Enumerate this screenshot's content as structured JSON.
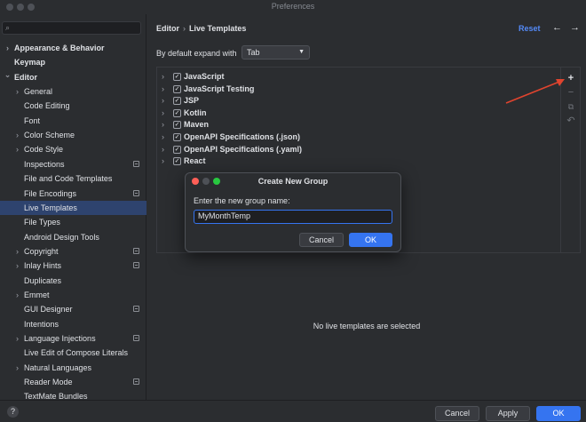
{
  "window": {
    "title": "Preferences"
  },
  "sidebar": {
    "items": [
      {
        "label": "Appearance & Behavior",
        "bold": true,
        "chevron": "right",
        "level": 0
      },
      {
        "label": "Keymap",
        "bold": true,
        "chevron": "",
        "level": 0
      },
      {
        "label": "Editor",
        "bold": true,
        "chevron": "down",
        "level": 0
      },
      {
        "label": "General",
        "chevron": "right",
        "level": 1
      },
      {
        "label": "Code Editing",
        "chevron": "",
        "level": 1
      },
      {
        "label": "Font",
        "chevron": "",
        "level": 1
      },
      {
        "label": "Color Scheme",
        "chevron": "right",
        "level": 1
      },
      {
        "label": "Code Style",
        "chevron": "right",
        "level": 1
      },
      {
        "label": "Inspections",
        "chevron": "",
        "level": 1,
        "badge": true
      },
      {
        "label": "File and Code Templates",
        "chevron": "",
        "level": 1
      },
      {
        "label": "File Encodings",
        "chevron": "",
        "level": 1,
        "badge": true
      },
      {
        "label": "Live Templates",
        "chevron": "",
        "level": 1,
        "selected": true
      },
      {
        "label": "File Types",
        "chevron": "",
        "level": 1
      },
      {
        "label": "Android Design Tools",
        "chevron": "",
        "level": 1
      },
      {
        "label": "Copyright",
        "chevron": "right",
        "level": 1,
        "badge": true
      },
      {
        "label": "Inlay Hints",
        "chevron": "right",
        "level": 1,
        "badge": true
      },
      {
        "label": "Duplicates",
        "chevron": "",
        "level": 1
      },
      {
        "label": "Emmet",
        "chevron": "right",
        "level": 1
      },
      {
        "label": "GUI Designer",
        "chevron": "",
        "level": 1,
        "badge": true
      },
      {
        "label": "Intentions",
        "chevron": "",
        "level": 1
      },
      {
        "label": "Language Injections",
        "chevron": "right",
        "level": 1,
        "badge": true
      },
      {
        "label": "Live Edit of Compose Literals",
        "chevron": "",
        "level": 1
      },
      {
        "label": "Natural Languages",
        "chevron": "right",
        "level": 1
      },
      {
        "label": "Reader Mode",
        "chevron": "",
        "level": 1,
        "badge": true
      },
      {
        "label": "TextMate Bundles",
        "chevron": "",
        "level": 1
      }
    ]
  },
  "header": {
    "breadcrumb": [
      "Editor",
      "Live Templates"
    ],
    "breadcrumb_sep": "›",
    "reset_label": "Reset",
    "back_icon": "←",
    "forward_icon": "→"
  },
  "expand": {
    "label": "By default expand with",
    "value": "Tab"
  },
  "template_groups": [
    {
      "name": "JavaScript",
      "checked": true
    },
    {
      "name": "JavaScript Testing",
      "checked": true
    },
    {
      "name": "JSP",
      "checked": true
    },
    {
      "name": "Kotlin",
      "checked": true
    },
    {
      "name": "Maven",
      "checked": true
    },
    {
      "name": "OpenAPI Specifications (.json)",
      "checked": true
    },
    {
      "name": "OpenAPI Specifications (.yaml)",
      "checked": true
    },
    {
      "name": "React",
      "checked": true
    }
  ],
  "toolbar_icons": {
    "add": "+",
    "remove": "−",
    "copy": "⧉",
    "revert": "↶"
  },
  "empty_message": "No live templates are selected",
  "dialog": {
    "title": "Create New Group",
    "prompt": "Enter the new group name:",
    "input_value": "MyMonthTemp",
    "cancel_label": "Cancel",
    "ok_label": "OK"
  },
  "footer": {
    "help_label": "?",
    "cancel_label": "Cancel",
    "apply_label": "Apply",
    "ok_label": "OK"
  },
  "colors": {
    "accent": "#3574f0",
    "link": "#548af7",
    "selection": "#2e436e",
    "annotation_arrow": "#e0442e"
  }
}
